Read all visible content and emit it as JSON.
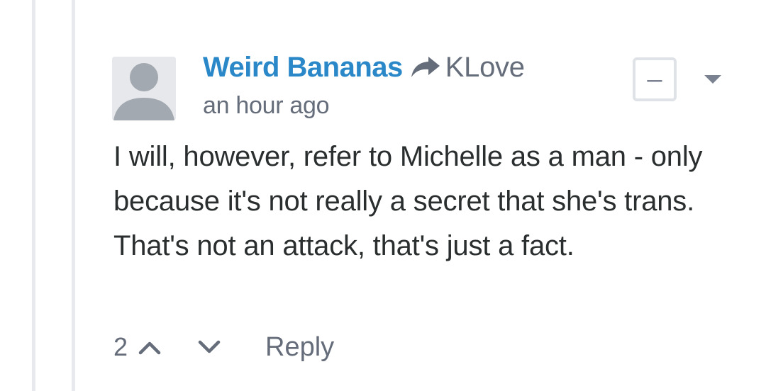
{
  "comment": {
    "author": "Weird Bananas",
    "reply_to": "KLove",
    "timestamp": "an hour ago",
    "collapse_label": "–",
    "body": "I will, however, refer to Michelle as a man - only because it's not really a secret that she's trans. That's not an attack, that's just a fact.",
    "votes": "2",
    "reply_label": "Reply"
  },
  "colors": {
    "author_link": "#2a88c8",
    "meta_text": "#656c7a",
    "body_text": "#2a2e2e",
    "thread_line": "#e7e9ee"
  },
  "icons": {
    "reply_arrow": "share-arrow-icon",
    "avatar": "default-avatar-icon",
    "upvote": "chevron-up-icon",
    "downvote": "chevron-down-icon",
    "menu": "caret-down-icon"
  }
}
